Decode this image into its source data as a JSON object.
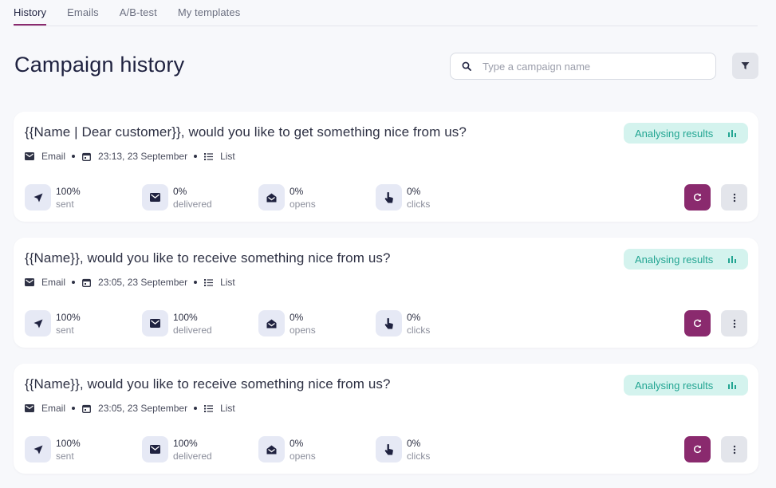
{
  "tabs": [
    {
      "label": "History",
      "active": true
    },
    {
      "label": "Emails",
      "active": false
    },
    {
      "label": "A/B-test",
      "active": false
    },
    {
      "label": "My templates",
      "active": false
    }
  ],
  "page_title": "Campaign history",
  "search": {
    "placeholder": "Type a campaign name",
    "value": ""
  },
  "colors": {
    "accent": "#8a2a6e",
    "status_bg": "#d4f3ee",
    "status_text": "#22a592"
  },
  "campaigns": [
    {
      "title": "{{Name | Dear customer}}, would you like to get something nice from us?",
      "status": "Analysing results",
      "channel": "Email",
      "datetime": "23:13, 23 September",
      "audience": "List",
      "stats": {
        "sent": {
          "value": "100%",
          "label": "sent"
        },
        "delivered": {
          "value": "0%",
          "label": "delivered"
        },
        "opens": {
          "value": "0%",
          "label": "opens"
        },
        "clicks": {
          "value": "0%",
          "label": "clicks"
        }
      }
    },
    {
      "title": "{{Name}}, would you like to receive something nice from us?",
      "status": "Analysing results",
      "channel": "Email",
      "datetime": "23:05, 23 September",
      "audience": "List",
      "stats": {
        "sent": {
          "value": "100%",
          "label": "sent"
        },
        "delivered": {
          "value": "100%",
          "label": "delivered"
        },
        "opens": {
          "value": "0%",
          "label": "opens"
        },
        "clicks": {
          "value": "0%",
          "label": "clicks"
        }
      }
    },
    {
      "title": "{{Name}}, would you like to receive something nice from us?",
      "status": "Analysing results",
      "channel": "Email",
      "datetime": "23:05, 23 September",
      "audience": "List",
      "stats": {
        "sent": {
          "value": "100%",
          "label": "sent"
        },
        "delivered": {
          "value": "100%",
          "label": "delivered"
        },
        "opens": {
          "value": "0%",
          "label": "opens"
        },
        "clicks": {
          "value": "0%",
          "label": "clicks"
        }
      }
    }
  ]
}
